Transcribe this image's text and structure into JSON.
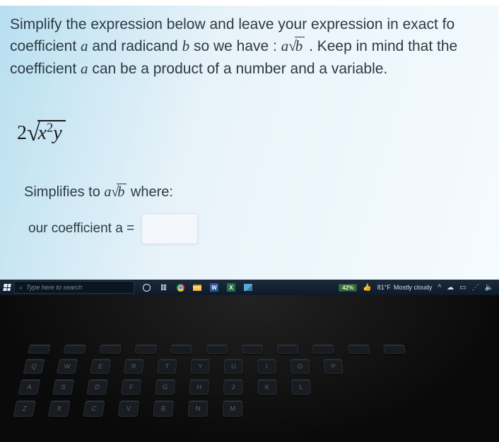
{
  "question": {
    "line1a": "Simplify the expression below and leave your expression in exact fo",
    "line2a": "coefficient ",
    "var_a": "a",
    "line2b": " and radicand ",
    "var_b": "b",
    "line2c": " so we have : ",
    "line2d": " . Keep in mind that the",
    "line3a": "coefficient ",
    "line3b": " can be a product of a number and a variable."
  },
  "asqrtb": {
    "a": "a",
    "surd": "√",
    "b": "b"
  },
  "expression": {
    "coef": "2",
    "surd": "√",
    "x": "x",
    "exp": "2",
    "y": "y"
  },
  "simplifies": {
    "pre": "Simplifies to ",
    "post": " where:"
  },
  "answer": {
    "label_pre": "our coefficient ",
    "label_var": "a",
    "label_eq": " = ",
    "value": ""
  },
  "taskbar": {
    "search_placeholder": "Type here to search",
    "battery": "42%",
    "weather_temp": "81°F",
    "weather_desc": "Mostly cloudy",
    "chevron": "^"
  },
  "keys": {
    "r2": [
      "Q",
      "W",
      "E",
      "R",
      "T",
      "Y",
      "U",
      "I",
      "O",
      "P"
    ],
    "r3": [
      "A",
      "S",
      "D",
      "F",
      "G",
      "H",
      "J",
      "K",
      "L"
    ],
    "r4": [
      "Z",
      "X",
      "C",
      "V",
      "B",
      "N",
      "M"
    ]
  }
}
